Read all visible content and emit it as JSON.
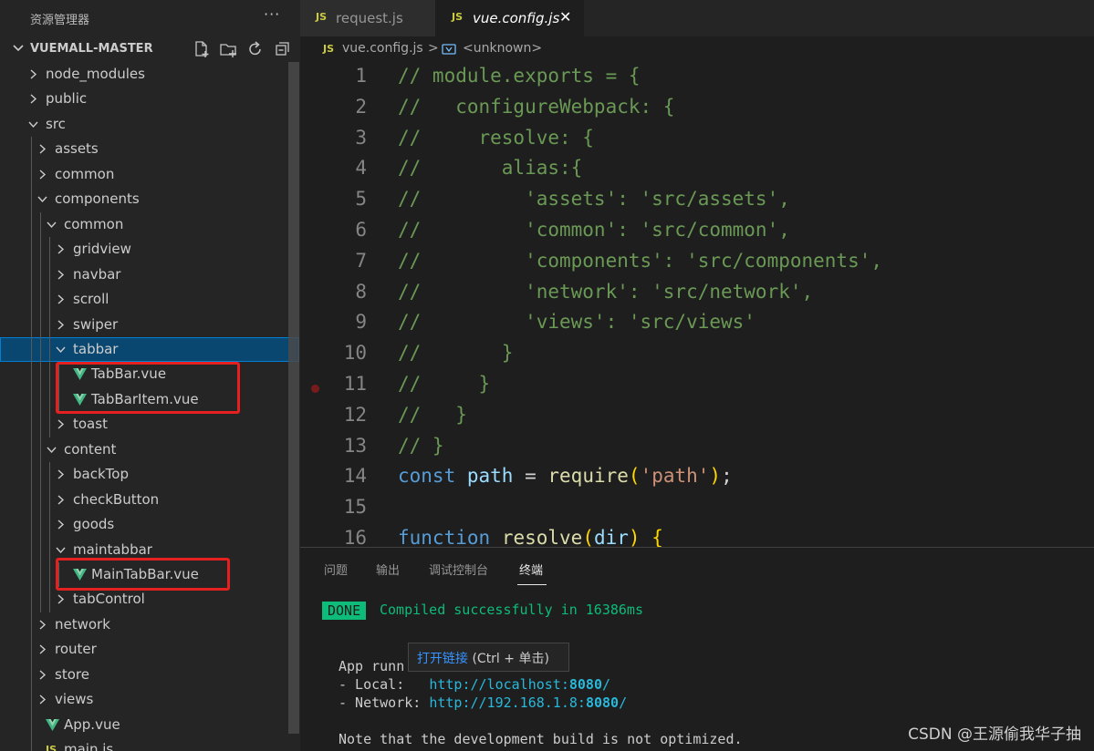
{
  "explorer": {
    "title": "资源管理器",
    "more": "···",
    "project": "VUEMALL-MASTER",
    "actions": [
      "new-file-icon",
      "new-folder-icon",
      "refresh-icon",
      "collapse-all-icon"
    ]
  },
  "tree": [
    {
      "label": "node_modules",
      "type": "folder",
      "expanded": false
    },
    {
      "label": "public",
      "type": "folder",
      "expanded": false
    },
    {
      "label": "src",
      "type": "folder",
      "expanded": true
    },
    {
      "label": "assets",
      "type": "folder",
      "expanded": false
    },
    {
      "label": "common",
      "type": "folder",
      "expanded": false
    },
    {
      "label": "components",
      "type": "folder",
      "expanded": true
    },
    {
      "label": "common",
      "type": "folder",
      "expanded": true
    },
    {
      "label": "gridview",
      "type": "folder",
      "expanded": false
    },
    {
      "label": "navbar",
      "type": "folder",
      "expanded": false
    },
    {
      "label": "scroll",
      "type": "folder",
      "expanded": false
    },
    {
      "label": "swiper",
      "type": "folder",
      "expanded": false
    },
    {
      "label": "tabbar",
      "type": "folder",
      "expanded": true,
      "selected": true
    },
    {
      "label": "TabBar.vue",
      "type": "vue"
    },
    {
      "label": "TabBarItem.vue",
      "type": "vue"
    },
    {
      "label": "toast",
      "type": "folder",
      "expanded": false
    },
    {
      "label": "content",
      "type": "folder",
      "expanded": true
    },
    {
      "label": "backTop",
      "type": "folder",
      "expanded": false
    },
    {
      "label": "checkButton",
      "type": "folder",
      "expanded": false
    },
    {
      "label": "goods",
      "type": "folder",
      "expanded": false
    },
    {
      "label": "maintabbar",
      "type": "folder",
      "expanded": true
    },
    {
      "label": "MainTabBar.vue",
      "type": "vue"
    },
    {
      "label": "tabControl",
      "type": "folder",
      "expanded": false
    },
    {
      "label": "network",
      "type": "folder",
      "expanded": false
    },
    {
      "label": "router",
      "type": "folder",
      "expanded": false
    },
    {
      "label": "store",
      "type": "folder",
      "expanded": false
    },
    {
      "label": "views",
      "type": "folder",
      "expanded": false
    },
    {
      "label": "App.vue",
      "type": "vue"
    },
    {
      "label": "main.js",
      "type": "js"
    }
  ],
  "tabs": [
    {
      "label": "request.js",
      "icon": "JS",
      "active": false
    },
    {
      "label": "vue.config.js",
      "icon": "JS",
      "active": true,
      "close": "✕"
    }
  ],
  "breadcrumb": {
    "file": "vue.config.js",
    "separator": ">",
    "symbol": "<unknown>",
    "icon": "JS"
  },
  "code": [
    {
      "n": "1",
      "t": "// module.exports = {"
    },
    {
      "n": "2",
      "t": "//   configureWebpack: {"
    },
    {
      "n": "3",
      "t": "//     resolve: {"
    },
    {
      "n": "4",
      "t": "//       alias:{"
    },
    {
      "n": "5",
      "t": "//         'assets': 'src/assets',"
    },
    {
      "n": "6",
      "t": "//         'common': 'src/common',"
    },
    {
      "n": "7",
      "t": "//         'components': 'src/components',"
    },
    {
      "n": "8",
      "t": "//         'network': 'src/network',"
    },
    {
      "n": "9",
      "t": "//         'views': 'src/views'"
    },
    {
      "n": "10",
      "t": "//       }"
    },
    {
      "n": "11",
      "t": "//     }"
    },
    {
      "n": "12",
      "t": "//   }"
    },
    {
      "n": "13",
      "t": "// }"
    },
    {
      "n": "14",
      "t": "const path = require('path');"
    },
    {
      "n": "15",
      "t": ""
    },
    {
      "n": "16",
      "t": "function resolve(dir) {"
    }
  ],
  "panel": {
    "tabs": [
      "问题",
      "输出",
      "调试控制台",
      "终端"
    ],
    "active_tab": "终端"
  },
  "terminal": {
    "done": "DONE",
    "compiled": "Compiled successfully in 16386ms",
    "app_running": "App runn",
    "local_label": "- Local:   ",
    "local_url": "http://localhost:",
    "local_port": "8080",
    "network_label": "- Network: ",
    "network_url": "http://192.168.1.8:",
    "network_port": "8080",
    "slash": "/",
    "note": "Note that the development build is not optimized."
  },
  "tooltip": {
    "link": "打开链接",
    "hint": " (Ctrl + 单击)"
  },
  "watermark": "CSDN @王源偷我华子抽",
  "colors": {
    "accent": "#007fd4",
    "selection": "#094771",
    "highlight_box": "#e61f1f",
    "done_green": "#0dbc79"
  }
}
